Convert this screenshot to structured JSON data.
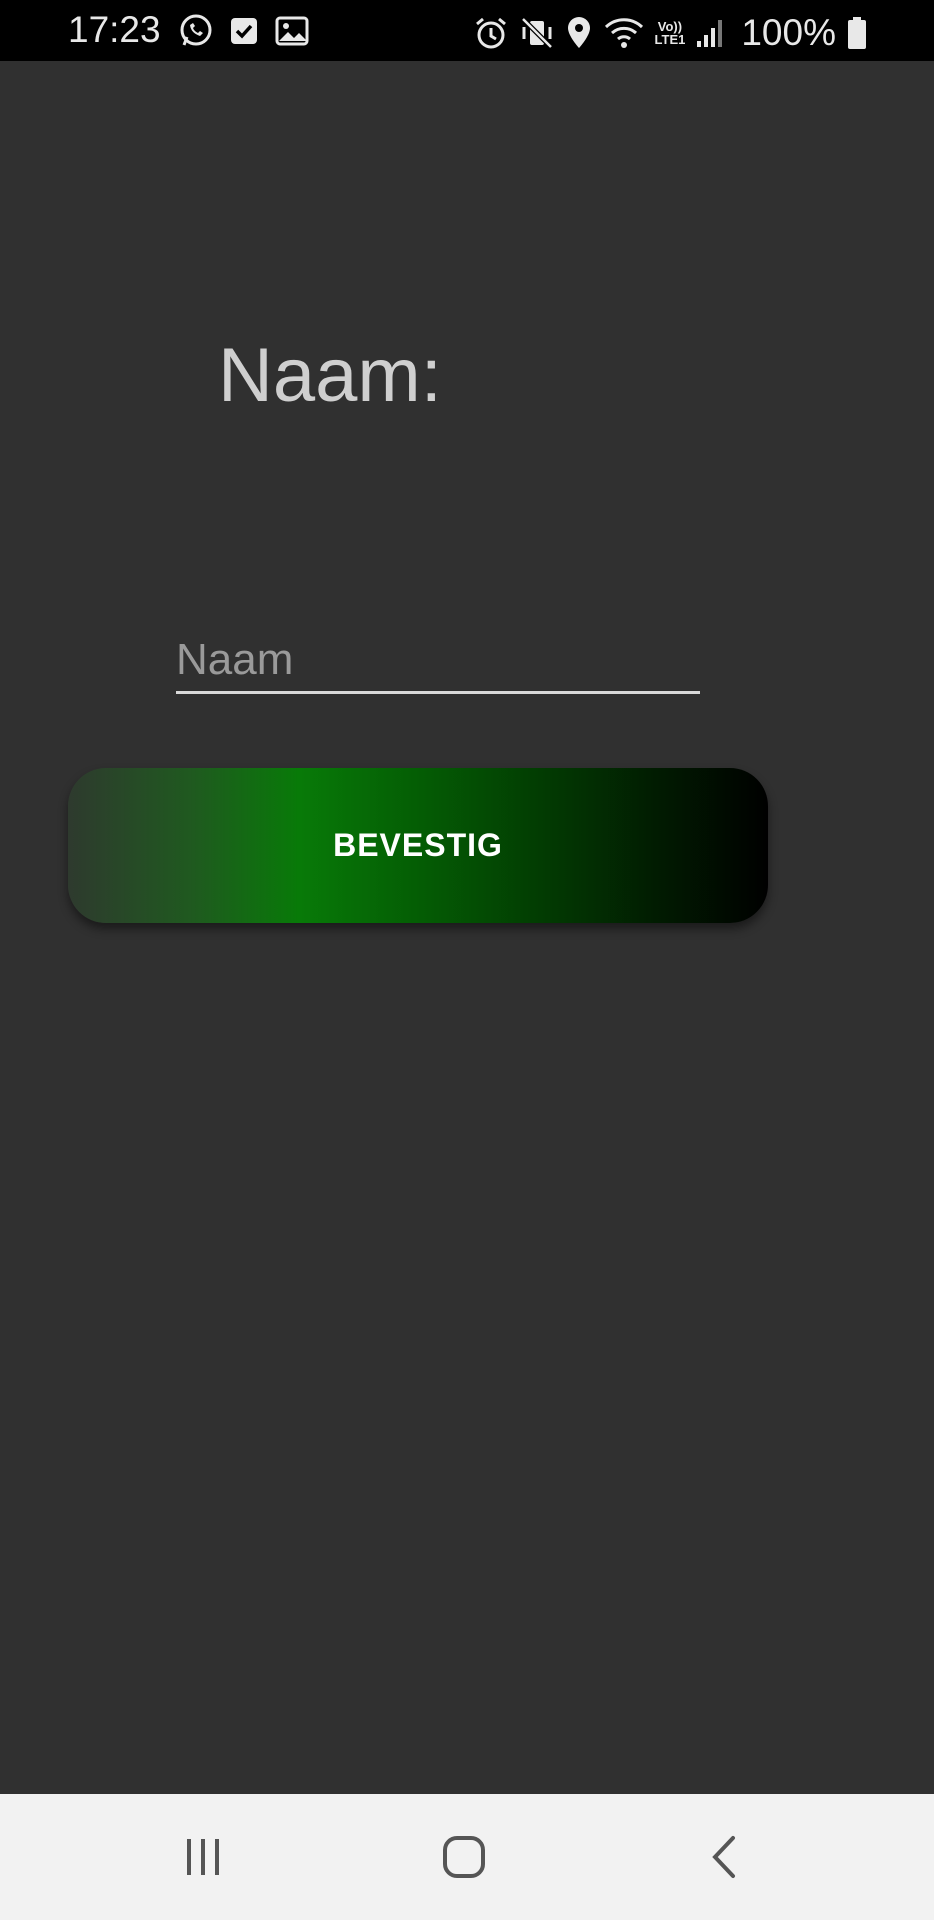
{
  "status_bar": {
    "time": "17:23",
    "battery": "100%",
    "network_label_top": "Vo))",
    "network_label_bottom": "LTE1",
    "left_icons": [
      "whatsapp-icon",
      "checkbox-notification-icon",
      "gallery-icon"
    ],
    "right_icons": [
      "alarm-icon",
      "vibrate-mute-icon",
      "location-icon",
      "wifi-icon",
      "lte-label",
      "signal-icon",
      "battery-icon"
    ]
  },
  "main": {
    "title": "Naam:",
    "name_input": {
      "placeholder": "Naam",
      "value": ""
    },
    "confirm_button_label": "BEVESTIG"
  },
  "nav_bar": {
    "buttons": [
      "recent-apps",
      "home",
      "back"
    ]
  },
  "colors": {
    "background": "#303030",
    "status_bar": "#000000",
    "nav_bar": "#f2f2f2",
    "button_gradient_start": "#2e3a2e",
    "button_gradient_mid": "#087a08",
    "button_gradient_end": "#000000"
  }
}
